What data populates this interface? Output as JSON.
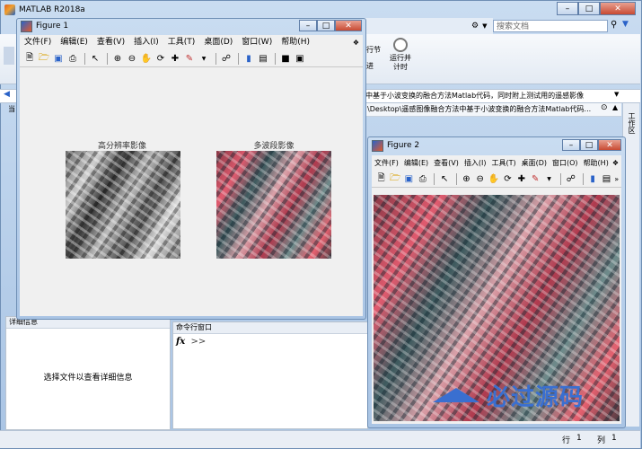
{
  "matlab": {
    "title": "MATLAB R2018a",
    "search_placeholder": "搜索文档",
    "ribbon": {
      "step_label": "行节",
      "advance_label": "进",
      "run_and_time_label": "运行并\n计时"
    },
    "path_bar_text": "中基于小波变换的融合方法Matlab代码，同时附上测试用的遥感影像",
    "path_text": "\\Desktop\\遥感图像融合方法中基于小波变换的融合方法Matlab代码...",
    "workspace_tab": "工作区",
    "details_panel": {
      "title": "详细信息",
      "message": "选择文件以查看详细信息"
    },
    "command_window": {
      "title": "命令行窗口",
      "fx_label": "fx",
      "prompt": ">>"
    },
    "statusbar": {
      "row_label": "行",
      "row_value": "1",
      "col_label": "列",
      "col_value": "1"
    },
    "left_labels": {
      "top": "当",
      "mid": "当"
    }
  },
  "figure1": {
    "title": "Figure 1",
    "menu": [
      "文件(F)",
      "编辑(E)",
      "查看(V)",
      "插入(I)",
      "工具(T)",
      "桌面(D)",
      "窗口(W)",
      "帮助(H)"
    ],
    "image_titles": {
      "left": "高分辨率影像",
      "right": "多波段影像"
    }
  },
  "figure2": {
    "title": "Figure 2",
    "menu": [
      "文件(F)",
      "编辑(E)",
      "查看(V)",
      "插入(I)",
      "工具(T)",
      "桌面(D)",
      "窗口(O)",
      "帮助(H)"
    ]
  },
  "watermark": "必过源码",
  "toolbar_icons": [
    "new-file-icon",
    "open-file-icon",
    "save-icon",
    "print-icon",
    "pointer-icon",
    "zoom-in-icon",
    "zoom-out-icon",
    "pan-icon",
    "rotate-icon",
    "data-cursor-icon",
    "brush-icon",
    "link-plot-icon",
    "colorbar-icon",
    "legend-icon",
    "hide-plot-tools-icon",
    "show-plot-tools-icon"
  ],
  "colors": {
    "accent": "#2a62c8",
    "titlebar": "#bcd3ee",
    "watermark": "#3a6fd0"
  }
}
